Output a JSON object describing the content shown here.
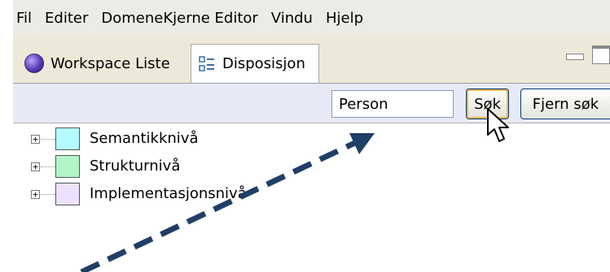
{
  "menubar": {
    "items": [
      "Fil",
      "Editer",
      "DomeneKjerne Editor",
      "Vindu",
      "Hjelp"
    ]
  },
  "tabs": [
    {
      "label": "Workspace Liste",
      "icon": "globe-icon"
    },
    {
      "label": "Disposisjon",
      "icon": "outline-icon"
    }
  ],
  "search": {
    "value": "Person"
  },
  "buttons": {
    "search_label": "Søk",
    "clear_label": "Fjern søk"
  },
  "tree": {
    "items": [
      {
        "label": "Semantikknivå",
        "color": "#b3fbff"
      },
      {
        "label": "Strukturnivå",
        "color": "#b3f5c6"
      },
      {
        "label": "Implementasjonsnivå",
        "color": "#ece2ff"
      }
    ]
  },
  "colors": {
    "arrow": "#1f3f66",
    "window_bg": "#ece9d8",
    "toolbar_bg": "#e7eaf6",
    "button_focus": "#f7b64a"
  }
}
